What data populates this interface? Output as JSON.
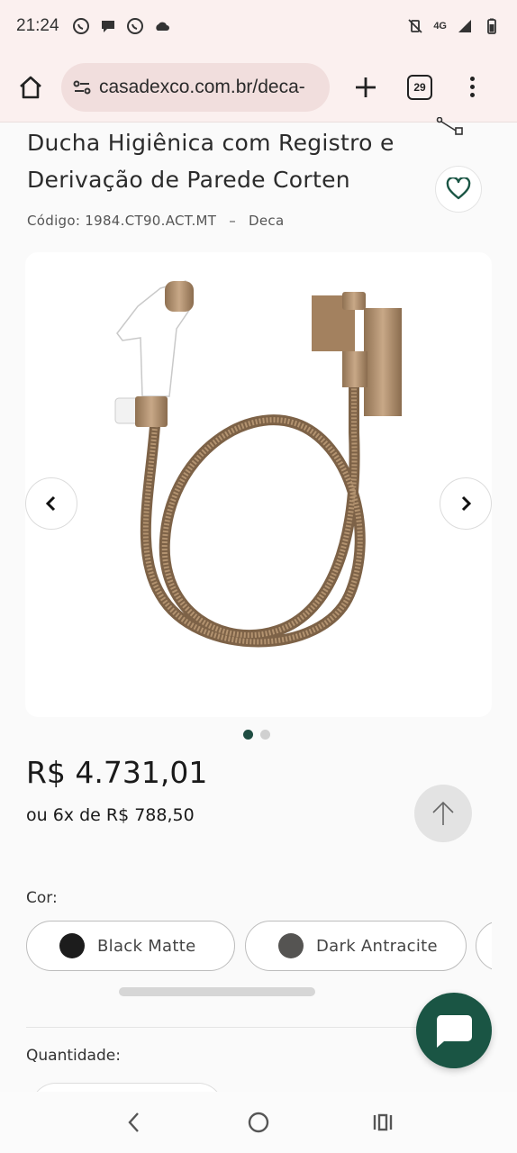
{
  "status_bar": {
    "time": "21:24",
    "network": "4G"
  },
  "browser": {
    "url": "casadexco.com.br/deca-",
    "tab_count": "29"
  },
  "product": {
    "title": "Ducha Higiênica com Registro e Derivação de Parede Corten",
    "code": "Código: 1984.CT90.ACT.MT",
    "separator": "–",
    "brand": "Deca",
    "image_alt": "ducha-higienica-image",
    "slide_count": 2,
    "active_slide": 1,
    "price": "R$ 4.731,01",
    "installments": "ou 6x de R$ 788,50"
  },
  "color_selector": {
    "label": "Cor:",
    "options": [
      {
        "label": "Black Matte",
        "swatch": "#1c1c1c"
      },
      {
        "label": "Dark Antracite",
        "swatch": "#555452"
      },
      {
        "label": "",
        "swatch": "#cccccc"
      }
    ]
  },
  "quantity": {
    "label": "Quantidade:"
  },
  "colors": {
    "accent": "#1a5544",
    "status_bg": "#fbf0ef",
    "url_pill": "#f1dedd",
    "corten": "#a98663"
  }
}
